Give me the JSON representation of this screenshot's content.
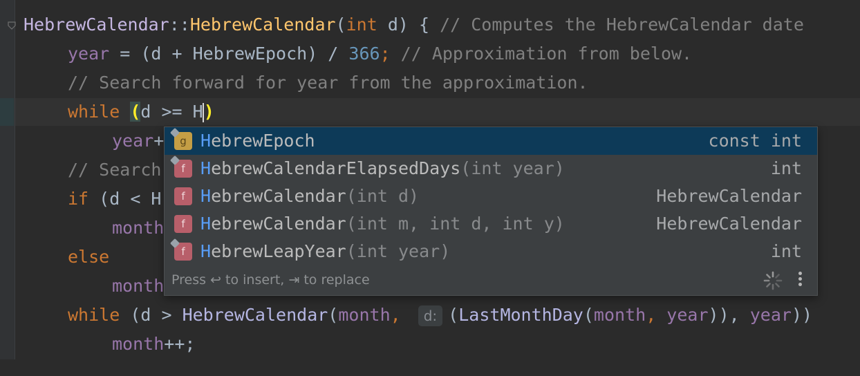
{
  "editor": {
    "lines": [
      {
        "id": "l1"
      },
      {
        "id": "l2"
      }
    ],
    "line1": {
      "cls": "HebrewCalendar",
      "sep": "::",
      "fn": "HebrewCalendar",
      "open": "(",
      "kw": "int",
      "rest": " d) { ",
      "comment": "// Computes the HebrewCalendar date"
    },
    "line2": {
      "field": "year",
      "op": " = (d + HebrewEpoch) / ",
      "num": "366",
      "semi": "; ",
      "comment": "// Approximation from below."
    },
    "line3": {
      "comment": "// Search forward for year from the approximation."
    },
    "line4": {
      "kw": "while",
      "sp": " ",
      "paren": "(",
      "mid": "d >= H",
      "close": ")"
    },
    "line5": {
      "field": "year",
      "rest": "+"
    },
    "line6": {
      "comment": "// Search"
    },
    "line7": {
      "kw": "if",
      "rest": " (d < H"
    },
    "line8": {
      "field": "month"
    },
    "line9": {
      "kw": "else"
    },
    "line10": {
      "field": "month"
    },
    "line11": {
      "kw": "while",
      "a": " (d > ",
      "cls": "HebrewCalendar",
      "b": "(",
      "field1": "month",
      "c": ", ",
      "hint": "d:",
      "d": "(",
      "fn2": "LastMonthDay",
      "e": "(",
      "field2": "month",
      "f": ", ",
      "field3": "year",
      "g": ")), ",
      "field4": "year",
      "h": "))"
    },
    "line12": {
      "field": "month",
      "rest": "++;"
    }
  },
  "completion": {
    "items": [
      {
        "icon": "g",
        "highlight": "H",
        "name": "ebrewEpoch",
        "params": "",
        "type": "const int",
        "selected": true
      },
      {
        "icon": "f",
        "highlight": "H",
        "name": "ebrewCalendarElapsedDays",
        "params": "(int year)",
        "type": "int",
        "selected": false
      },
      {
        "icon": "f",
        "highlight": "H",
        "name": "ebrewCalendar",
        "params": "(int d)",
        "type": "HebrewCalendar",
        "selected": false
      },
      {
        "icon": "f",
        "highlight": "H",
        "name": "ebrewCalendar",
        "params": "(int m, int d, int y)",
        "type": "HebrewCalendar",
        "selected": false
      },
      {
        "icon": "f",
        "highlight": "H",
        "name": "ebrewLeapYear",
        "params": "(int year)",
        "type": "int",
        "selected": false
      }
    ],
    "footer": "Press ↩ to insert, ⇥ to replace"
  }
}
